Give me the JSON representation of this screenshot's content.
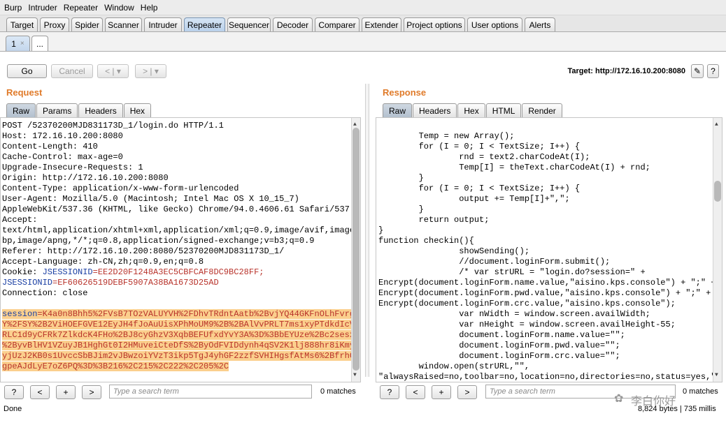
{
  "menu": [
    "Burp",
    "Intruder",
    "Repeater",
    "Window",
    "Help"
  ],
  "tabs": [
    "Target",
    "Proxy",
    "Spider",
    "Scanner",
    "Intruder",
    "Repeater",
    "Sequencer",
    "Decoder",
    "Comparer",
    "Extender",
    "Project options",
    "User options",
    "Alerts"
  ],
  "active_tab": "Repeater",
  "subtabs": {
    "first": "1",
    "close": "×",
    "more": "..."
  },
  "toolbar": {
    "go": "Go",
    "cancel": "Cancel",
    "back": "< | ▾",
    "fwd": "> | ▾",
    "target": "Target: http://172.16.10.200:8080",
    "edit_icon": "✎",
    "help": "?"
  },
  "request": {
    "title": "Request",
    "tabs": [
      "Raw",
      "Params",
      "Headers",
      "Hex"
    ],
    "lines": [
      "POST /52370200MJD831173D_1/login.do HTTP/1.1",
      "Host: 172.16.10.200:8080",
      "Content-Length: 410",
      "Cache-Control: max-age=0",
      "Upgrade-Insecure-Requests: 1",
      "Origin: http://172.16.10.200:8080",
      "Content-Type: application/x-www-form-urlencoded",
      "User-Agent: Mozilla/5.0 (Macintosh; Intel Mac OS X 10_15_7)",
      "AppleWebKit/537.36 (KHTML, like Gecko) Chrome/94.0.4606.61 Safari/537.36",
      "Accept:",
      "text/html,application/xhtml+xml,application/xml;q=0.9,image/avif,image/we",
      "bp,image/apng,*/*;q=0.8,application/signed-exchange;v=b3;q=0.9",
      "Referer: http://172.16.10.200:8080/52370200MJD831173D_1/",
      "Accept-Language: zh-CN,zh;q=0.9,en;q=0.8"
    ],
    "cookie_label": "Cookie: ",
    "cookie_key1": "JSESSIONID",
    "cookie_val1": "=EE2D20F1248A3EC5CBFCAF8DC9BC28FF;",
    "cookie_key2": "JSESSIONID",
    "cookie_val2": "=EF60626519DEBF5907A38BA1673D25AD",
    "connection": "Connection: close",
    "session_key": "session",
    "session_lines": [
      "=K4a0n8Bhh5%2FVsB7TOzVALUYVH%2FDhvTRdntAatb%2BvjYQ44GKFnOLhFvrg1WN",
      "Y%2FSY%2B2ViHOEFGVE12EyJH4fJoAuUisXPhMoUM9%2B%2BAlVvPRLT7ms1xyPTdkdIcV0je",
      "RLC1d9yCFRk7ZlkdcK4FHo%2BJ8cyGhzV3XqbBEFUfxdYvY3A%3D%3BbEYUze%2Bc2sesxswp",
      "%2ByvBlHV1VZuyJB1HghGt0I2HMuveiCteDfS%2ByOdFVIDdynh4qSV2K1lj888hr8iKmyiEzZ",
      "yjUzJ2KB0s1UvccSbBJim2vJBwzoiYVzT3ikp5TgJ4yhGF2zzfSVHIHgsfAtMs6%2BfrhG2XO",
      "gpeAJdLyE7oZ6PQ%3D%3B216%2C215%2C222%2C205%2C"
    ]
  },
  "response": {
    "title": "Response",
    "tabs": [
      "Raw",
      "Headers",
      "Hex",
      "HTML",
      "Render"
    ],
    "lines": [
      "        Temp = new Array();",
      "        for (I = 0; I < TextSize; I++) {",
      "                rnd = text2.charCodeAt(I);",
      "                Temp[I] = theText.charCodeAt(I) + rnd;",
      "        }",
      "        for (I = 0; I < TextSize; I++) {",
      "                output += Temp[I]+\",\";",
      "        }",
      "        return output;",
      "}",
      "function checkin(){",
      "                showSending();",
      "                //document.loginForm.submit();",
      "                /* var strURL = \"login.do?session=\" +",
      "Encrypt(document.loginForm.name.value,\"aisino.kps.console\") + \";\" +",
      "Encrypt(document.loginForm.pwd.value,\"aisino.kps.console\") + \";\" +",
      "Encrypt(document.loginForm.crc.value,\"aisino.kps.console\");",
      "                var nWidth = window.screen.availWidth;",
      "                var nHeight = window.screen.availHeight-55;",
      "                document.loginForm.name.value=\"\";",
      "                document.loginForm.pwd.value=\"\";",
      "                document.loginForm.crc.value=\"\";",
      "        window.open(strURL,\"\",",
      "\"alwaysRaised=no,toolbar=no,location=no,directories=no,status=yes,\" +"
    ]
  },
  "search": {
    "help": "?",
    "prev": "<",
    "plus": "+",
    "next": ">",
    "placeholder": "Type a search term",
    "left_matches": "0 matches",
    "right_matches": "0 matches"
  },
  "status": {
    "left": "Done",
    "right": "8,824 bytes | 735 millis"
  },
  "watermark": "李白你好"
}
